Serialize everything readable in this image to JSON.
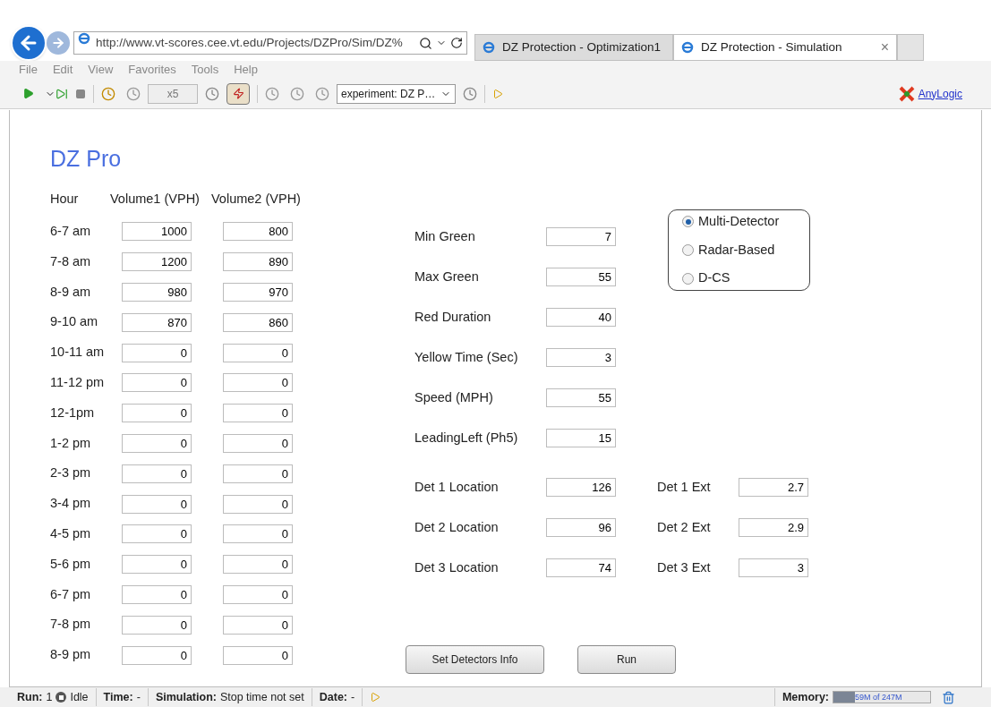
{
  "browser": {
    "url": "http://www.vt-scores.cee.vt.edu/Projects/DZPro/Sim/DZ%",
    "tabs": [
      {
        "title": "DZ Protection - Optimization1",
        "selected": false
      },
      {
        "title": "DZ Protection - Simulation",
        "selected": true
      }
    ],
    "close_tab": "×",
    "menu": [
      "File",
      "Edit",
      "View",
      "Favorites",
      "Tools",
      "Help"
    ]
  },
  "toolbar": {
    "speed": "x5",
    "experiment": "experiment: DZ P…",
    "brand": "AnyLogic"
  },
  "title": "DZ Pro",
  "volume_table": {
    "columns": [
      "Hour",
      "Volume1 (VPH)",
      "Volume2 (VPH)"
    ],
    "rows": [
      [
        "6-7 am",
        "1000",
        "800"
      ],
      [
        "7-8 am",
        "1200",
        "890"
      ],
      [
        "8-9 am",
        "980",
        "970"
      ],
      [
        "9-10 am",
        "870",
        "860"
      ],
      [
        "10-11 am",
        "0",
        "0"
      ],
      [
        "11-12 pm",
        "0",
        "0"
      ],
      [
        "12-1pm",
        "0",
        "0"
      ],
      [
        "1-2 pm",
        "0",
        "0"
      ],
      [
        "2-3 pm",
        "0",
        "0"
      ],
      [
        "3-4 pm",
        "0",
        "0"
      ],
      [
        "4-5 pm",
        "0",
        "0"
      ],
      [
        "5-6 pm",
        "0",
        "0"
      ],
      [
        "6-7 pm",
        "0",
        "0"
      ],
      [
        "7-8 pm",
        "0",
        "0"
      ],
      [
        "8-9 pm",
        "0",
        "0"
      ]
    ]
  },
  "signal_fields": [
    {
      "label": "Min Green",
      "value": "7"
    },
    {
      "label": "Max Green",
      "value": "55"
    },
    {
      "label": "Red Duration",
      "value": "40"
    },
    {
      "label": "Yellow Time (Sec)",
      "value": "3"
    },
    {
      "label": "Speed (MPH)",
      "value": "55"
    },
    {
      "label": "LeadingLeft (Ph5)",
      "value": "15"
    }
  ],
  "detectors": [
    {
      "label": "Det 1 Location",
      "value": "126",
      "ext_label": "Det 1 Ext",
      "ext_value": "2.7"
    },
    {
      "label": "Det 2 Location",
      "value": "96",
      "ext_label": "Det 2 Ext",
      "ext_value": "2.9"
    },
    {
      "label": "Det 3 Location",
      "value": "74",
      "ext_label": "Det 3 Ext",
      "ext_value": "3"
    }
  ],
  "detector_type": [
    {
      "label": "Multi-Detector",
      "selected": true
    },
    {
      "label": "Radar-Based",
      "selected": false
    },
    {
      "label": "D-CS",
      "selected": false
    }
  ],
  "buttons": [
    "Set Detectors Info",
    "Run"
  ],
  "status_bar": {
    "run": {
      "label": "Run:",
      "value": "1",
      "state": "Idle"
    },
    "items": [
      {
        "label": "Time:",
        "value": "-"
      },
      {
        "label": "Simulation:",
        "value": "Stop time not set"
      },
      {
        "label": "Date:",
        "value": "-"
      }
    ],
    "memory": {
      "label": "Memory:",
      "text": "59M of 247M",
      "level": 0.22
    }
  }
}
